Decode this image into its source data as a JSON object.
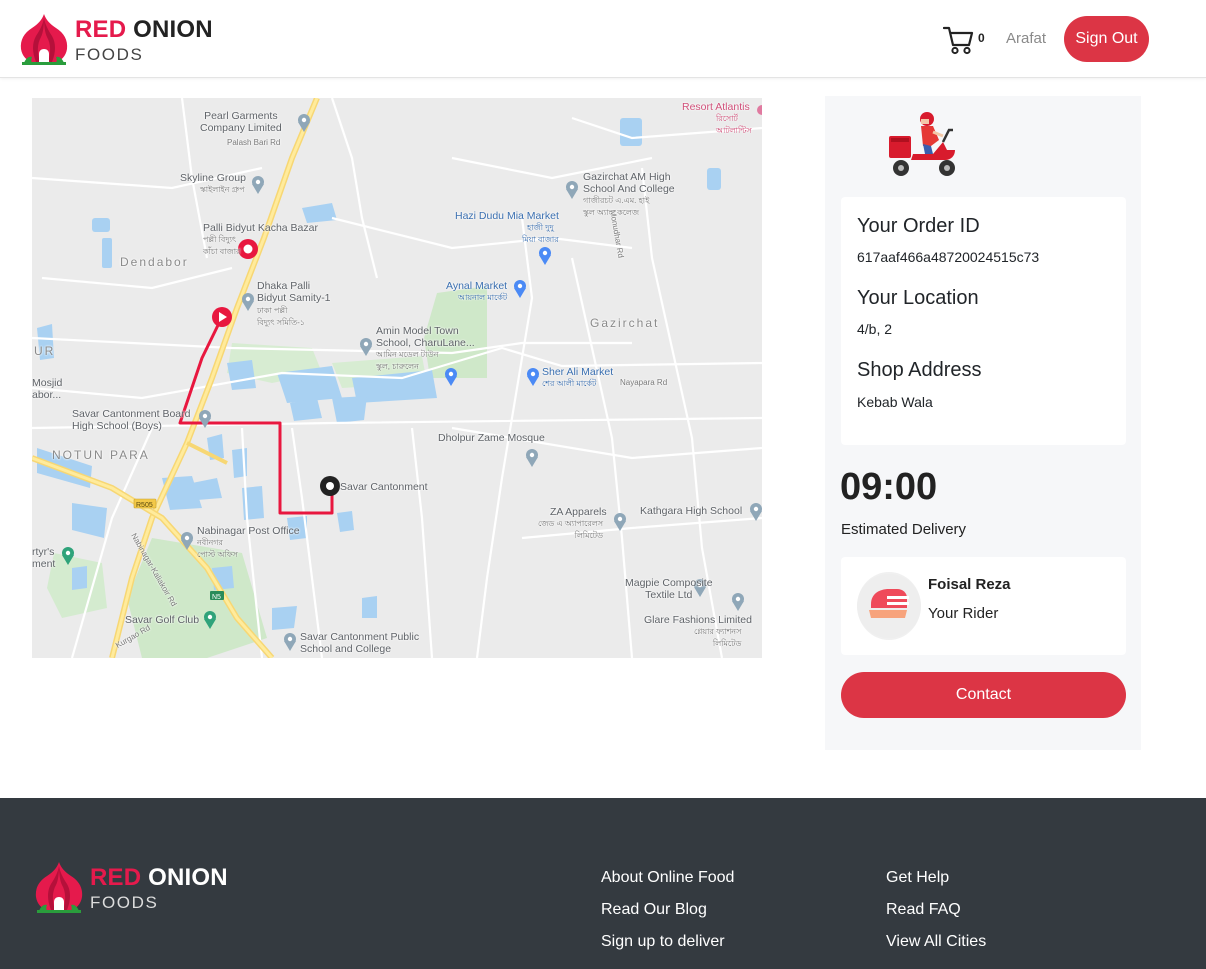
{
  "header": {
    "logo": {
      "text_red": "RED",
      "text_dark": "ONION",
      "subtitle": "FOODS"
    },
    "cart_count": "0",
    "user_name": "Arafat",
    "signout_label": "Sign Out"
  },
  "map": {
    "labels": {
      "pearl": "Pearl Garments\nCompany Limited",
      "palash": "Palash Bari Rd",
      "skyline": "Skyline Group",
      "skyline_bn": "স্কাইলাইন গ্রুপ",
      "resort": "Resort Atlantis",
      "resort_bn": "রিসোর্ট\nআটলান্টিস",
      "gazirchat_school": "Gazirchat AM High\nSchool And College",
      "gazirchat_school_bn": "গাজীরচট এ.এম. হাই\nস্কুল অ্যান্ড কলেজ",
      "hazi": "Hazi Dudu Mia Market",
      "hazi_bn": "হাজী দুদু\nমিয়া বাজার",
      "palli_bidyut": "Palli Bidyut Kacha Bazar",
      "palli_bidyut_bn": "পল্লী বিদ্যুৎ\nকাঁচা বাজার",
      "dendabor": "Dendabor",
      "dhaka_palli": "Dhaka Palli\nBidyut Samity-1",
      "dhaka_palli_bn": "ঢাকা পল্লী\nবিদ্যুৎ সমিতি-১",
      "aynal": "Aynal Market",
      "aynal_bn": "আয়নাল মার্কেট",
      "gazirchat": "Gazirchat",
      "amin": "Amin Model Town\nSchool, CharuLane...",
      "amin_bn": "আমিন মডেল টাউন\nস্কুল, চারুলেন",
      "sher_ali": "Sher Ali Market",
      "sher_ali_bn": "শের আলী মার্কেট",
      "ur": "UR",
      "mosjid": "Mosjid\nabor...",
      "savar_board": "Savar Cantonment Board\nHigh School (Boys)",
      "notun_para": "NOTUN PARA",
      "dhoulpur": "Dholpur Zame Mosque",
      "savar_cant": "Savar Cantonment",
      "za_apparels": "ZA Apparels",
      "za_apparels_bn": "জেড এ অ্যাপারেলস\nলিমিটেড",
      "kathgara": "Kathgara High School",
      "nabinagar": "Nabinagar Post Office",
      "nabinagar_bn": "নবীনগর\nপোস্ট অফিস",
      "martyrs": "rtyr's\nment",
      "magpie": "Magpie Composite\nTextile Ltd",
      "savar_golf": "Savar Golf Club",
      "glare": "Glare Fashions Limited",
      "glare_bn": "গ্লেয়ার ফ্যাশনস\nলিমিটেড",
      "savar_public": "Savar Cantonment Public\nSchool and College",
      "r505": "R505",
      "n5": "N5",
      "nayapara": "Nayapara Rd",
      "kurgao": "Kurgao Rd",
      "monudhar": "Monudhar Rd",
      "nabinagar_rd": "Nabinagar-Kaliakoir Rd"
    }
  },
  "order": {
    "id_heading": "Your Order ID",
    "id_value": "617aaf466a48720024515c73",
    "location_heading": "Your Location",
    "location_value": "4/b, 2",
    "shop_heading": "Shop Address",
    "shop_value": "Kebab Wala",
    "time": "09:00",
    "time_label": "Estimated Delivery",
    "rider_name": "Foisal Reza",
    "rider_role": "Your Rider",
    "contact_label": "Contact"
  },
  "footer": {
    "logo": {
      "text_red": "RED",
      "text_dark": "ONION",
      "subtitle": "FOODS"
    },
    "col1": [
      "About Online Food",
      "Read Our Blog",
      "Sign up to deliver"
    ],
    "col2": [
      "Get Help",
      "Read FAQ",
      "View All Cities"
    ]
  },
  "colors": {
    "brand": "#dc3545",
    "logo_red": "#e51a4c",
    "footer_bg": "#343a40",
    "route": "#e8173f"
  },
  "icons": [
    "onion-logo-icon",
    "cart-icon",
    "map-pin-icon",
    "start-marker-icon",
    "destination-marker-icon",
    "delivery-scooter-icon",
    "rider-avatar-icon"
  ]
}
